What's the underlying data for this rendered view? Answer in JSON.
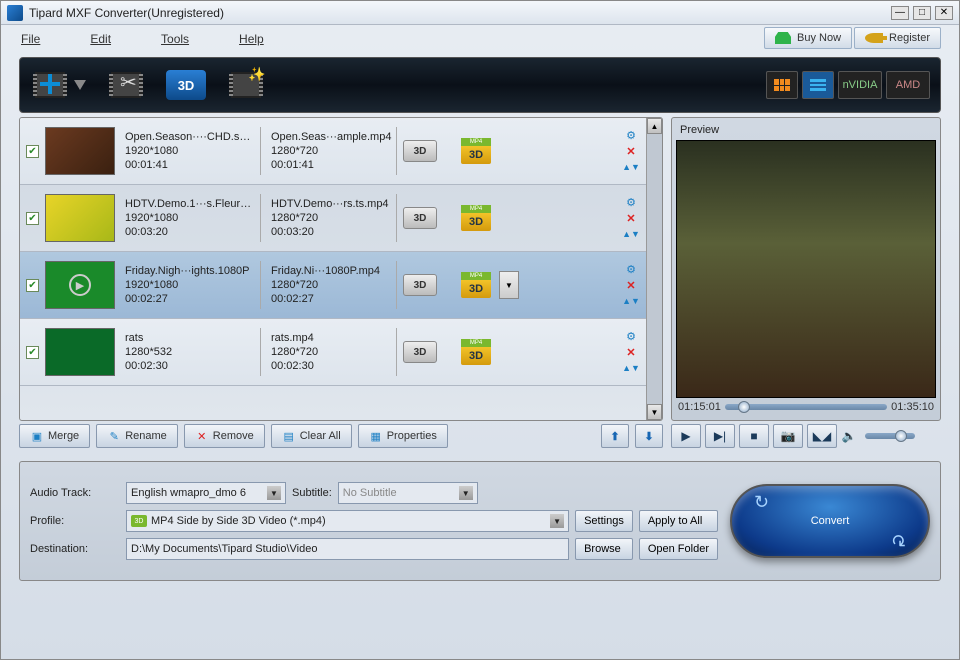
{
  "window": {
    "title": "Tipard MXF Converter(Unregistered)"
  },
  "menu": {
    "file": "File",
    "edit": "Edit",
    "tools": "Tools",
    "help": "Help"
  },
  "special": {
    "buy": "Buy Now",
    "register": "Register"
  },
  "gpu": {
    "nvidia": "nVIDIA",
    "amd": "AMD"
  },
  "files": [
    {
      "name": "Open.Season····CHD.sample",
      "res": "1920*1080",
      "dur": "00:01:41",
      "out": "Open.Seas···ample.mp4",
      "outres": "1280*720",
      "outdur": "00:01:41"
    },
    {
      "name": "HDTV.Demo.1···s.Fleurs.ts",
      "res": "1920*1080",
      "dur": "00:03:20",
      "out": "HDTV.Demo···rs.ts.mp4",
      "outres": "1280*720",
      "outdur": "00:03:20"
    },
    {
      "name": "Friday.Nigh···ights.1080P",
      "res": "1920*1080",
      "dur": "00:02:27",
      "out": "Friday.Ni···1080P.mp4",
      "outres": "1280*720",
      "outdur": "00:02:27"
    },
    {
      "name": "rats",
      "res": "1280*532",
      "dur": "00:02:30",
      "out": "rats.mp4",
      "outres": "1280*720",
      "outdur": "00:02:30"
    }
  ],
  "badges": {
    "d3": "3D",
    "mp4": "MP4"
  },
  "footer": {
    "merge": "Merge",
    "rename": "Rename",
    "remove": "Remove",
    "clear": "Clear All",
    "props": "Properties"
  },
  "preview": {
    "label": "Preview",
    "t_cur": "01:15:01",
    "t_end": "01:35:10"
  },
  "settings": {
    "audio_label": "Audio Track:",
    "audio_value": "English wmapro_dmo 6",
    "subtitle_label": "Subtitle:",
    "subtitle_value": "No Subtitle",
    "profile_label": "Profile:",
    "profile_value": "MP4 Side by Side 3D Video (*.mp4)",
    "profile_badge": "3D",
    "dest_label": "Destination:",
    "dest_value": "D:\\My Documents\\Tipard Studio\\Video",
    "settings_btn": "Settings",
    "apply_btn": "Apply to All",
    "browse_btn": "Browse",
    "open_btn": "Open Folder"
  },
  "convert": "Convert"
}
